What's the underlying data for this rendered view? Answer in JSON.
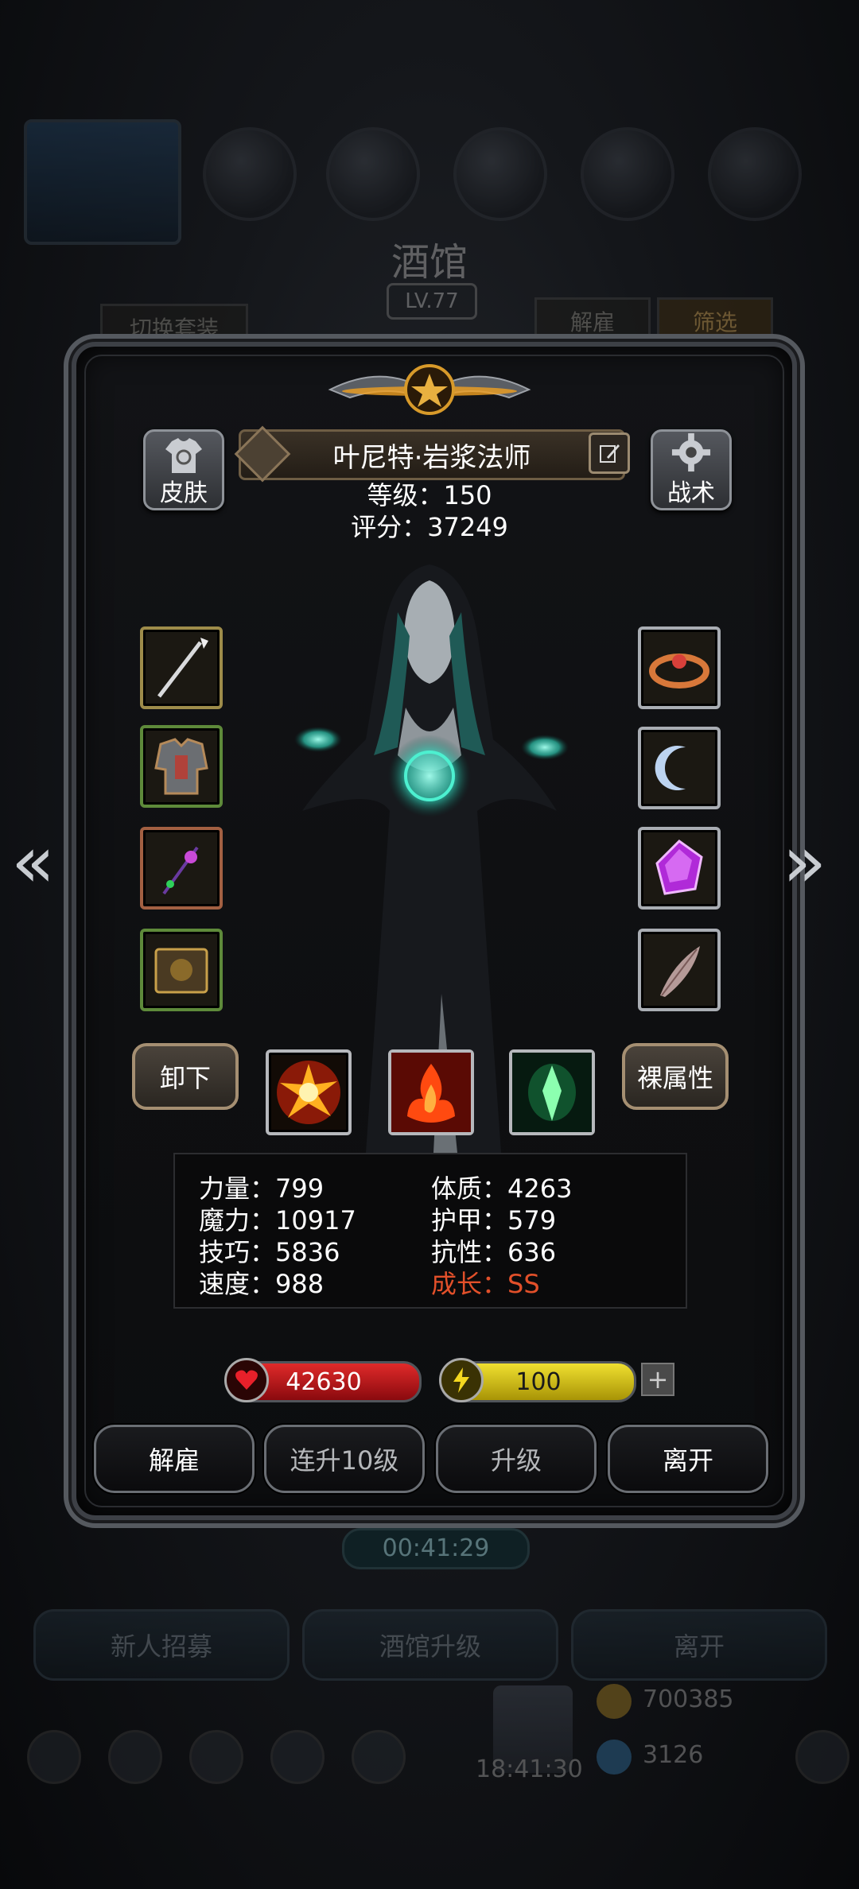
{
  "background": {
    "title": "酒馆",
    "level_badge": "LV.77",
    "switch_outfit_button": "切换套装",
    "dismiss_tab": "解雇",
    "filter_tab": "筛选",
    "timer": "00:41:29",
    "bottom_buttons": [
      "新人招募",
      "酒馆升级",
      "离开"
    ],
    "gold_value": "700385",
    "gem_value": "3126",
    "clock": "18:41:30"
  },
  "hero": {
    "name": "叶尼特·岩浆法师",
    "level_text": "等级：150",
    "score_text": "评分：37249",
    "skin_button": "皮肤",
    "tactics_button": "战术",
    "unequip_button": "卸下",
    "base_attr_button": "裸属性"
  },
  "stats": {
    "left": [
      "力量：799",
      "魔力：10917",
      "技巧：5836",
      "速度：988"
    ],
    "right": [
      "体质：4263",
      "护甲：579",
      "抗性：636"
    ],
    "growth": "成长：SS"
  },
  "resources": {
    "hp_value": "42630",
    "energy_value": "100",
    "hp_color": "#c0151c",
    "energy_color": "#d7c418"
  },
  "actions": {
    "dismiss": "解雇",
    "upgrade10": "连升10级",
    "upgrade": "升级",
    "leave": "离开"
  },
  "icons": {
    "equipment_left": [
      "spear-icon",
      "armor-icon",
      "staff-icon",
      "book-icon"
    ],
    "equipment_right": [
      "ring-icon",
      "moon-amulet-icon",
      "purple-gem-icon",
      "feather-icon"
    ],
    "skills": [
      "explosion-skill-icon",
      "fire-skill-icon",
      "green-crystal-skill-icon"
    ]
  }
}
